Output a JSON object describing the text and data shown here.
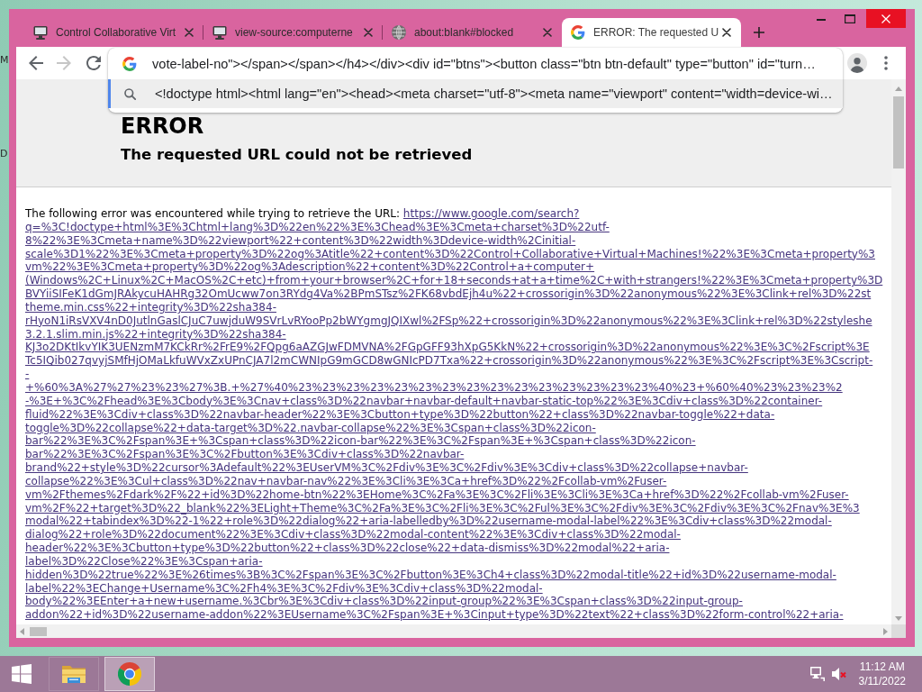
{
  "desktop": {
    "icon_labels": [
      "M",
      "D"
    ]
  },
  "browser": {
    "tabs": [
      {
        "kind": "site",
        "title": "Control Collaborative Virt",
        "selected": false
      },
      {
        "kind": "site",
        "title": "view-source:computerne",
        "selected": false
      },
      {
        "kind": "blank",
        "title": "about:blank#blocked",
        "selected": false
      },
      {
        "kind": "search",
        "title": "ERROR: The requested U",
        "selected": true
      }
    ],
    "toolbar": {
      "back": {
        "disabled": false
      },
      "forward": {
        "disabled": true
      }
    },
    "omnibox": {
      "value": "vote-label-no\"></span></span></h4></div><div id=\"btns\"><button class=\"btn btn-default\" type=\"button\" id=\"turn…",
      "suggestions": [
        {
          "text": "<!doctype html><html lang=\"en\"><head><meta charset=\"utf-8\"><meta name=\"viewport\" content=\"width=device-wi…",
          "selected": true
        }
      ]
    }
  },
  "page": {
    "error_title": "ERROR",
    "heading": "The requested URL could not be retrieved",
    "intro": "The following error was encountered while trying to retrieve the URL:",
    "url_lines": [
      "https://www.google.com/search?",
      "q=%3C!doctype+html%3E%3Chtml+lang%3D%22en%22%3E%3Chead%3E%3Cmeta+charset%3D%22utf-",
      "8%22%3E%3Cmeta+name%3D%22viewport%22+content%3D%22width%3Ddevice-width%2Cinitial-",
      "scale%3D1%22%3E%3Cmeta+property%3D%22og%3Atitle%22+content%3D%22Control+Collaborative+Virtual+Machines!%22%3E%3Cmeta+property%3",
      "vm%22%3E%3Cmeta+property%3D%22og%3Adescription%22+content%3D%22Control+a+computer+",
      "(Windows%2C+Linux%2C+MacOS%2C+etc)+from+your+browser%2C+for+18+seconds+at+a+time%2C+with+strangers!%22%3E%3Cmeta+property%3D",
      "BVYiiSIFeK1dGmJRAkycuHAHRg32OmUcww7on3RYdg4Va%2BPmSTsz%2FK68vbdEjh4u%22+crossorigin%3D%22anonymous%22%3E%3Clink+rel%3D%22st",
      "theme.min.css%22+integrity%3D%22sha384-",
      "rHyoN1iRsVXV4nD0JutlnGaslCJuC7uwjduW9SVrLvRYooPp2bWYgmgJQIXwl%2FSp%22+crossorigin%3D%22anonymous%22%3E%3Clink+rel%3D%22styleshe",
      "3.2.1.slim.min.js%22+integrity%3D%22sha384-",
      "KJ3o2DKtIkvYIK3UENzmM7KCkRr%2FrE9%2FQpg6aAZGJwFDMVNA%2FGpGFF93hXpG5KkN%22+crossorigin%3D%22anonymous%22%3E%3C%2Fscript%3E",
      "Tc5IQib027qvyjSMfHjOMaLkfuWVxZxUPnCJA7l2mCWNIpG9mGCD8wGNIcPD7Txa%22+crossorigin%3D%22anonymous%22%3E%3C%2Fscript%3E%3Cscript-",
      "-",
      "+%60%3A%27%27%23%23%27%3B.+%27%40%23%23%23%23%23%23%23%23%23%23%23%23%23%23%23%40%23+%60%40%23%23%23%2",
      "-%3E+%3C%2Fhead%3E%3Cbody%3E%3Cnav+class%3D%22navbar+navbar-default+navbar-static-top%22%3E%3Cdiv+class%3D%22container-",
      "fluid%22%3E%3Cdiv+class%3D%22navbar-header%22%3E%3Cbutton+type%3D%22button%22+class%3D%22navbar-toggle%22+data-",
      "toggle%3D%22collapse%22+data-target%3D%22.navbar-collapse%22%3E%3Cspan+class%3D%22icon-",
      "bar%22%3E%3C%2Fspan%3E+%3Cspan+class%3D%22icon-bar%22%3E%3C%2Fspan%3E+%3Cspan+class%3D%22icon-",
      "bar%22%3E%3C%2Fspan%3E%3C%2Fbutton%3E%3Cdiv+class%3D%22navbar-",
      "brand%22+style%3D%22cursor%3Adefault%22%3EUserVM%3C%2Fdiv%3E%3C%2Fdiv%3E%3Cdiv+class%3D%22collapse+navbar-",
      "collapse%22%3E%3Cul+class%3D%22nav+navbar-nav%22%3E%3Cli%3E%3Ca+href%3D%22%2Fcollab-vm%2Fuser-",
      "vm%2Fthemes%2Fdark%2F%22+id%3D%22home-btn%22%3EHome%3C%2Fa%3E%3C%2Fli%3E%3Cli%3E%3Ca+href%3D%22%2Fcollab-vm%2Fuser-",
      "vm%2F%22+target%3D%22_blank%22%3ELight+Theme%3C%2Fa%3E%3C%2Fli%3E%3C%2Ful%3E%3C%2Fdiv%3E%3C%2Fdiv%3E%3C%2Fnav%3E%3",
      "modal%22+tabindex%3D%22-1%22+role%3D%22dialog%22+aria-labelledby%3D%22username-modal-label%22%3E%3Cdiv+class%3D%22modal-",
      "dialog%22+role%3D%22document%22%3E%3Cdiv+class%3D%22modal-content%22%3E%3Cdiv+class%3D%22modal-",
      "header%22%3E%3Cbutton+type%3D%22button%22+class%3D%22close%22+data-dismiss%3D%22modal%22+aria-",
      "label%3D%22Close%22%3E%3Cspan+aria-",
      "hidden%3D%22true%22%3E%26times%3B%3C%2Fspan%3E%3C%2Fbutton%3E%3Ch4+class%3D%22modal-title%22+id%3D%22username-modal-",
      "label%22%3EChange+Username%3C%2Fh4%3E%3C%2Fdiv%3E%3Cdiv+class%3D%22modal-",
      "body%22%3EEnter+a+new+username.%3Cbr%3E%3Cdiv+class%3D%22input-group%22%3E%3Cspan+class%3D%22input-group-",
      "addon%22+id%3D%22username-addon%22%3EUsername%3C%2Fspan%3E+%3Cinput+type%3D%22text%22+class%3D%22form-control%22+aria-"
    ]
  },
  "taskbar": {
    "apps": [
      {
        "kind": "explorer",
        "active": false
      },
      {
        "kind": "chrome",
        "active": true
      }
    ],
    "volume": {
      "muted": true
    },
    "time": "11:12 AM",
    "date": "3/11/2022"
  }
}
